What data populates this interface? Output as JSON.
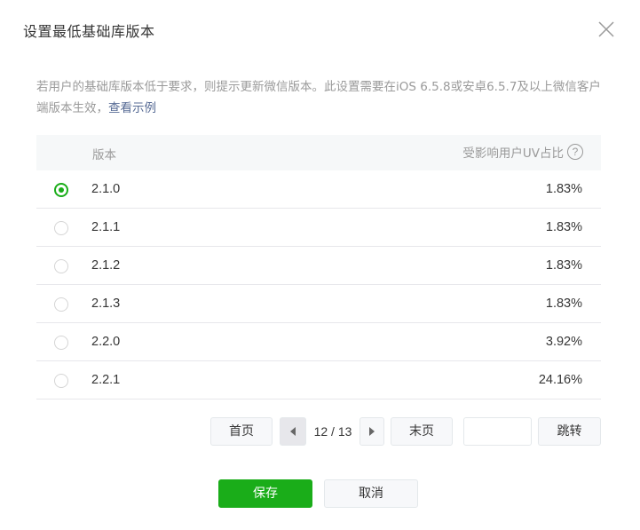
{
  "dialog": {
    "title": "设置最低基础库版本",
    "description": "若用户的基础库版本低于要求，则提示更新微信版本。此设置需要在iOS 6.5.8或安卓6.5.7及以上微信客户端版本生效，",
    "example_link": "查看示例"
  },
  "table": {
    "header_version": "版本",
    "header_uv": "受影响用户UV占比",
    "help_glyph": "?",
    "rows": [
      {
        "version": "2.1.0",
        "uv": "1.83%",
        "selected": true
      },
      {
        "version": "2.1.1",
        "uv": "1.83%",
        "selected": false
      },
      {
        "version": "2.1.2",
        "uv": "1.83%",
        "selected": false
      },
      {
        "version": "2.1.3",
        "uv": "1.83%",
        "selected": false
      },
      {
        "version": "2.2.0",
        "uv": "3.92%",
        "selected": false
      },
      {
        "version": "2.2.1",
        "uv": "24.16%",
        "selected": false
      }
    ]
  },
  "pager": {
    "first_label": "首页",
    "indicator": "12 / 13",
    "last_label": "末页",
    "jump_value": "",
    "jump_label": "跳转"
  },
  "footer": {
    "save_label": "保存",
    "cancel_label": "取消"
  },
  "colors": {
    "accent": "#1aad19",
    "link": "#576b95"
  }
}
